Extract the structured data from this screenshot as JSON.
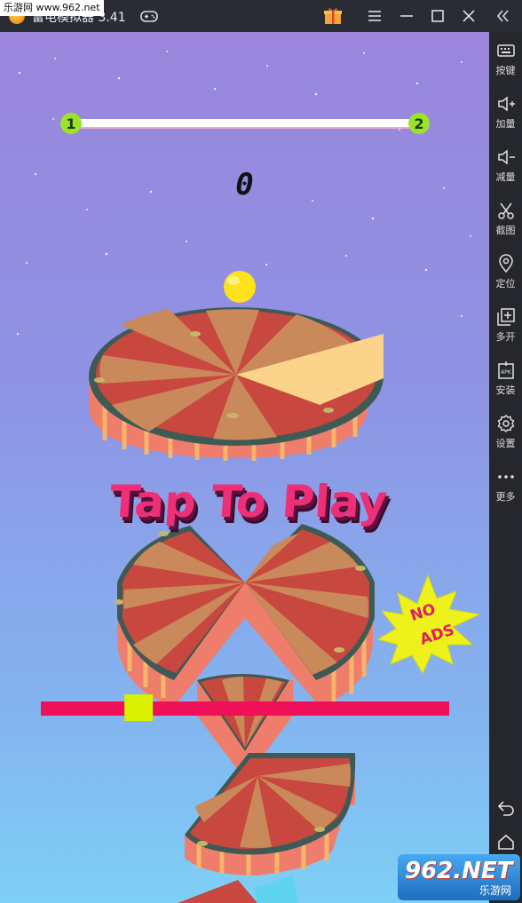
{
  "window": {
    "watermark_top": "乐游网 www.962.net",
    "title": "雷电模拟器 3.41",
    "icons": [
      "gamepad-icon",
      "gift-icon",
      "menu-icon",
      "minimize-icon",
      "maximize-icon",
      "close-icon",
      "collapse-icon"
    ]
  },
  "sidebar": {
    "items": [
      {
        "icon": "keyboard-icon",
        "label": "按键"
      },
      {
        "icon": "volume-up-icon",
        "label": "加量"
      },
      {
        "icon": "volume-down-icon",
        "label": "减量"
      },
      {
        "icon": "scissors-icon",
        "label": "截图"
      },
      {
        "icon": "location-icon",
        "label": "定位"
      },
      {
        "icon": "multi-instance-icon",
        "label": "多开"
      },
      {
        "icon": "apk-icon",
        "label": "安装"
      },
      {
        "icon": "settings-icon",
        "label": "设置"
      },
      {
        "icon": "more-icon",
        "label": "更多"
      }
    ],
    "bottom_icons": [
      "back-icon",
      "home-icon"
    ]
  },
  "game": {
    "level_current": "1",
    "level_next": "2",
    "level_progress": 0,
    "score": "0",
    "prompt": "Tap To Play",
    "no_ads_line1": "NO",
    "no_ads_line2": "ADS",
    "slider_position": 0.22,
    "colors": {
      "progress_bar": "#ffffff",
      "level_badge": "#9be22a",
      "slider_track": "#f0105a",
      "slider_handle": "#d8f100",
      "prompt_text": "#ee2f76",
      "ball": "#ffe21b",
      "disc_red": "#c9473e",
      "disc_tan": "#c9895a",
      "disc_side": "#f07a6a"
    }
  },
  "watermark_bottom": {
    "big": "962.NET",
    "small": "乐游网"
  }
}
